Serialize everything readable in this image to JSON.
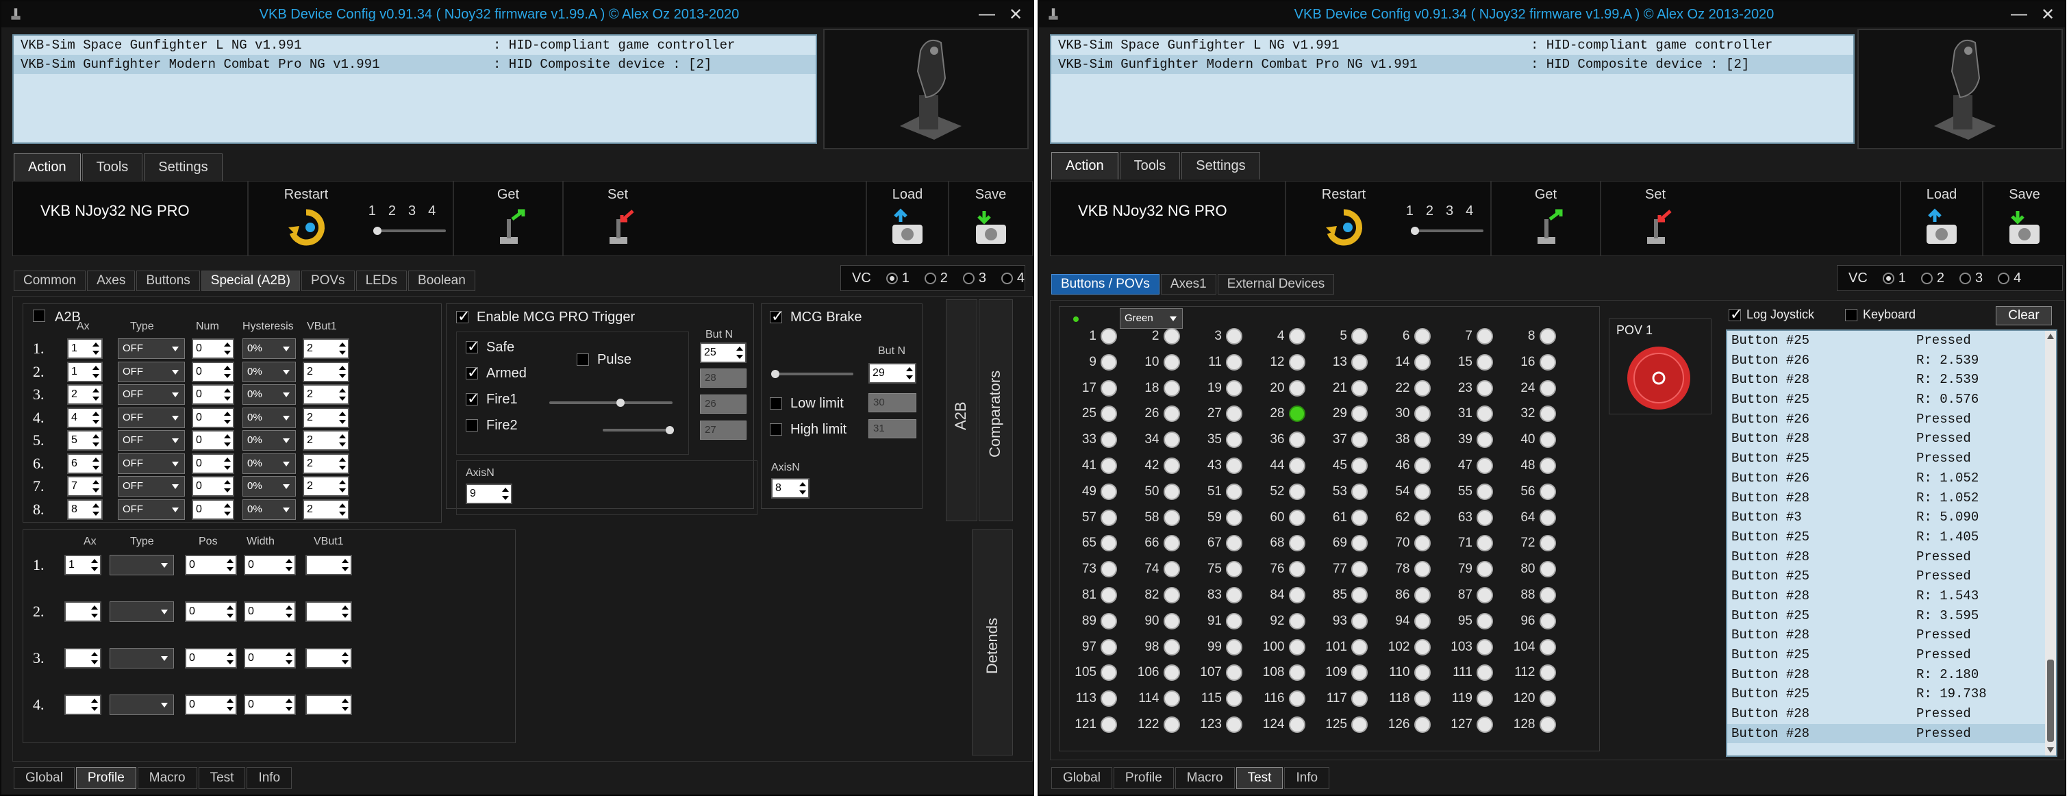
{
  "window_title": "VKB Device Config v0.91.34 ( NJoy32 firmware v1.99.A ) © Alex Oz 2013-2020",
  "window_controls": {
    "minimize": "—",
    "close": "✕"
  },
  "devices": [
    {
      "name": "VKB-Sim Space Gunfighter L NG v1.991",
      "type": ": HID-compliant game controller"
    },
    {
      "name": "VKB-Sim Gunfighter Modern Combat Pro NG v1.991",
      "type": ": HID Composite device : [2]"
    }
  ],
  "main_tabs": [
    "Action",
    "Tools",
    "Settings"
  ],
  "toolbar": {
    "device_name": "VKB NJoy32 NG PRO",
    "restart": "Restart",
    "get": "Get",
    "set": "Set",
    "load": "Load",
    "save": "Save",
    "slots": [
      "1",
      "2",
      "3",
      "4"
    ]
  },
  "vc": {
    "label": "VC",
    "options": [
      "1",
      "2",
      "3",
      "4"
    ],
    "selected": "1"
  },
  "left": {
    "subtabs": [
      "Common",
      "Axes",
      "Buttons",
      "Special (A2B)",
      "POVs",
      "LEDs",
      "Boolean"
    ],
    "a2b": {
      "title": "A2B",
      "headers": {
        "ax": "Ax",
        "type": "Type",
        "num": "Num",
        "hyst": "Hysteresis",
        "vbut": "VBut1"
      },
      "rows": [
        {
          "n": "1.",
          "ax": "1",
          "type": "OFF",
          "num": "0",
          "hyst": "0%",
          "vbut": "2"
        },
        {
          "n": "2.",
          "ax": "1",
          "type": "OFF",
          "num": "0",
          "hyst": "0%",
          "vbut": "2"
        },
        {
          "n": "3.",
          "ax": "2",
          "type": "OFF",
          "num": "0",
          "hyst": "0%",
          "vbut": "2"
        },
        {
          "n": "4.",
          "ax": "4",
          "type": "OFF",
          "num": "0",
          "hyst": "0%",
          "vbut": "2"
        },
        {
          "n": "5.",
          "ax": "5",
          "type": "OFF",
          "num": "0",
          "hyst": "0%",
          "vbut": "2"
        },
        {
          "n": "6.",
          "ax": "6",
          "type": "OFF",
          "num": "0",
          "hyst": "0%",
          "vbut": "2"
        },
        {
          "n": "7.",
          "ax": "7",
          "type": "OFF",
          "num": "0",
          "hyst": "0%",
          "vbut": "2"
        },
        {
          "n": "8.",
          "ax": "8",
          "type": "OFF",
          "num": "0",
          "hyst": "0%",
          "vbut": "2"
        }
      ]
    },
    "mcg": {
      "enable": "Enable MCG PRO Trigger",
      "butn": "But N",
      "safe": "Safe",
      "armed": "Armed",
      "pulse": "Pulse",
      "fire1": "Fire1",
      "fire2": "Fire2",
      "b25": "25",
      "b28": "28",
      "b26": "26",
      "b27": "27",
      "axisn": "AxisN",
      "axis": "9"
    },
    "brake": {
      "label": "MCG Brake",
      "butn": "But N",
      "b29": "29",
      "low": "Low limit",
      "high": "High limit",
      "lowv": "30",
      "highv": "31",
      "axisn": "AxisN",
      "axis": "8"
    },
    "comparators": {
      "a2b": "A2B",
      "label": "Comparators"
    },
    "detents": {
      "label": "Detends",
      "headers": {
        "ax": "Ax",
        "type": "Type",
        "pos": "Pos",
        "width": "Width",
        "vbut": "VBut1"
      },
      "rows": [
        {
          "n": "1.",
          "ax": "1",
          "pos": "0",
          "width": "0"
        },
        {
          "n": "2.",
          "ax": "",
          "pos": "0",
          "width": "0"
        },
        {
          "n": "3.",
          "ax": "",
          "pos": "0",
          "width": "0"
        },
        {
          "n": "4.",
          "ax": "",
          "pos": "0",
          "width": "0"
        }
      ]
    },
    "bottom_tabs": [
      "Global",
      "Profile",
      "Macro",
      "Test",
      "Info"
    ]
  },
  "right": {
    "subtabs": [
      "Buttons / POVs",
      "Axes1",
      "External Devices"
    ],
    "color": "Green",
    "active_button": "28",
    "pov": "POV 1",
    "log_joystick": "Log Joystick",
    "keyboard": "Keyboard",
    "clear": "Clear",
    "log": [
      [
        "Button #25",
        "Pressed"
      ],
      [
        "Button #26",
        "R: 2.539"
      ],
      [
        "Button #28",
        "R: 2.539"
      ],
      [
        "Button #25",
        "R: 0.576"
      ],
      [
        "Button #26",
        "Pressed"
      ],
      [
        "Button #28",
        "Pressed"
      ],
      [
        "Button #25",
        "Pressed"
      ],
      [
        "Button #26",
        "R: 1.052"
      ],
      [
        "Button #28",
        "R: 1.052"
      ],
      [
        "Button #3",
        "R: 5.090"
      ],
      [
        "Button #25",
        "R: 1.405"
      ],
      [
        "Button #28",
        "Pressed"
      ],
      [
        "Button #25",
        "Pressed"
      ],
      [
        "Button #28",
        "R: 1.543"
      ],
      [
        "Button #25",
        "R: 3.595"
      ],
      [
        "Button #28",
        "Pressed"
      ],
      [
        "Button #25",
        "Pressed"
      ],
      [
        "Button #28",
        "R: 2.180"
      ],
      [
        "Button #25",
        "R: 19.738"
      ],
      [
        "Button #28",
        "Pressed"
      ],
      [
        "Button #28",
        "Pressed"
      ]
    ],
    "bottom_tabs": [
      "Global",
      "Profile",
      "Macro",
      "Test",
      "Info"
    ]
  },
  "colors": {
    "accent_blue": "#2aa7e8",
    "pressed_green": "#44d11a",
    "pov_red": "#d62b2b"
  }
}
